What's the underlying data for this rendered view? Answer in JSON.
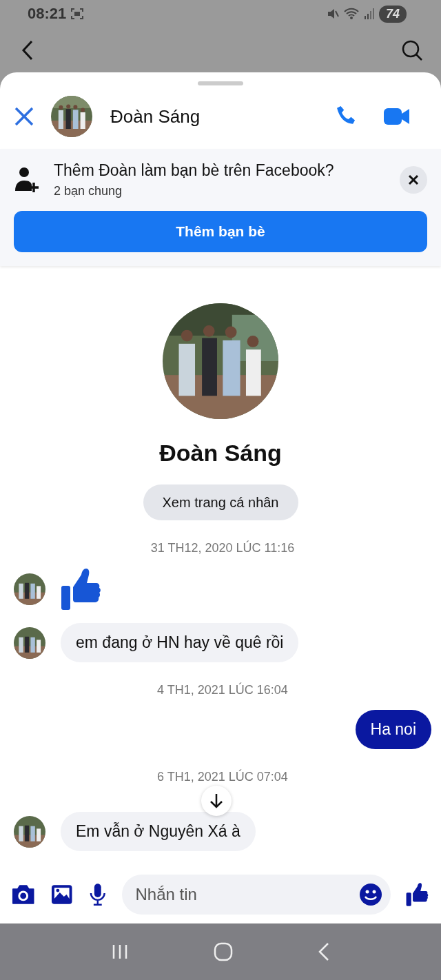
{
  "status_bar": {
    "time": "08:21",
    "battery": "74"
  },
  "header": {
    "name": "Đoàn Sáng"
  },
  "friend_banner": {
    "title": "Thêm Đoàn làm bạn bè trên Facebook?",
    "subtitle": "2 bạn chung",
    "button": "Thêm bạn bè"
  },
  "profile": {
    "name": "Đoàn Sáng",
    "button": "Xem trang cá nhân"
  },
  "messages": [
    {
      "kind": "time",
      "text": "31 TH12, 2020 LÚC 11:16"
    },
    {
      "kind": "like"
    },
    {
      "kind": "incoming",
      "text": "em đang ở HN hay về quê rồi"
    },
    {
      "kind": "time",
      "text": "4 TH1, 2021 LÚC 16:04"
    },
    {
      "kind": "outgoing",
      "text": "Ha noi"
    },
    {
      "kind": "time",
      "text": "6 TH1, 2021 LÚC 07:04"
    },
    {
      "kind": "incoming",
      "text": "Em vẫn ở Nguyên Xá à"
    }
  ],
  "composer": {
    "placeholder": "Nhắn tin"
  }
}
